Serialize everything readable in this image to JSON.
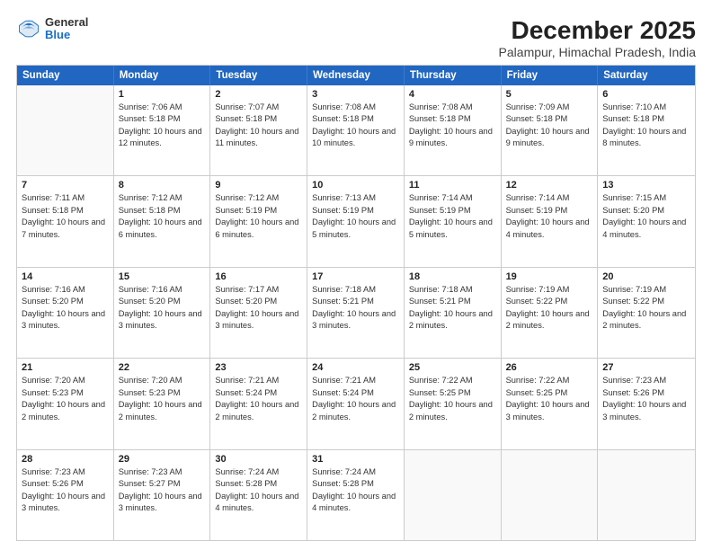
{
  "logo": {
    "general": "General",
    "blue": "Blue"
  },
  "title": "December 2025",
  "subtitle": "Palampur, Himachal Pradesh, India",
  "header_days": [
    "Sunday",
    "Monday",
    "Tuesday",
    "Wednesday",
    "Thursday",
    "Friday",
    "Saturday"
  ],
  "weeks": [
    [
      {
        "day": "",
        "sunrise": "",
        "sunset": "",
        "daylight": ""
      },
      {
        "day": "1",
        "sunrise": "Sunrise: 7:06 AM",
        "sunset": "Sunset: 5:18 PM",
        "daylight": "Daylight: 10 hours and 12 minutes."
      },
      {
        "day": "2",
        "sunrise": "Sunrise: 7:07 AM",
        "sunset": "Sunset: 5:18 PM",
        "daylight": "Daylight: 10 hours and 11 minutes."
      },
      {
        "day": "3",
        "sunrise": "Sunrise: 7:08 AM",
        "sunset": "Sunset: 5:18 PM",
        "daylight": "Daylight: 10 hours and 10 minutes."
      },
      {
        "day": "4",
        "sunrise": "Sunrise: 7:08 AM",
        "sunset": "Sunset: 5:18 PM",
        "daylight": "Daylight: 10 hours and 9 minutes."
      },
      {
        "day": "5",
        "sunrise": "Sunrise: 7:09 AM",
        "sunset": "Sunset: 5:18 PM",
        "daylight": "Daylight: 10 hours and 9 minutes."
      },
      {
        "day": "6",
        "sunrise": "Sunrise: 7:10 AM",
        "sunset": "Sunset: 5:18 PM",
        "daylight": "Daylight: 10 hours and 8 minutes."
      }
    ],
    [
      {
        "day": "7",
        "sunrise": "Sunrise: 7:11 AM",
        "sunset": "Sunset: 5:18 PM",
        "daylight": "Daylight: 10 hours and 7 minutes."
      },
      {
        "day": "8",
        "sunrise": "Sunrise: 7:12 AM",
        "sunset": "Sunset: 5:18 PM",
        "daylight": "Daylight: 10 hours and 6 minutes."
      },
      {
        "day": "9",
        "sunrise": "Sunrise: 7:12 AM",
        "sunset": "Sunset: 5:19 PM",
        "daylight": "Daylight: 10 hours and 6 minutes."
      },
      {
        "day": "10",
        "sunrise": "Sunrise: 7:13 AM",
        "sunset": "Sunset: 5:19 PM",
        "daylight": "Daylight: 10 hours and 5 minutes."
      },
      {
        "day": "11",
        "sunrise": "Sunrise: 7:14 AM",
        "sunset": "Sunset: 5:19 PM",
        "daylight": "Daylight: 10 hours and 5 minutes."
      },
      {
        "day": "12",
        "sunrise": "Sunrise: 7:14 AM",
        "sunset": "Sunset: 5:19 PM",
        "daylight": "Daylight: 10 hours and 4 minutes."
      },
      {
        "day": "13",
        "sunrise": "Sunrise: 7:15 AM",
        "sunset": "Sunset: 5:20 PM",
        "daylight": "Daylight: 10 hours and 4 minutes."
      }
    ],
    [
      {
        "day": "14",
        "sunrise": "Sunrise: 7:16 AM",
        "sunset": "Sunset: 5:20 PM",
        "daylight": "Daylight: 10 hours and 3 minutes."
      },
      {
        "day": "15",
        "sunrise": "Sunrise: 7:16 AM",
        "sunset": "Sunset: 5:20 PM",
        "daylight": "Daylight: 10 hours and 3 minutes."
      },
      {
        "day": "16",
        "sunrise": "Sunrise: 7:17 AM",
        "sunset": "Sunset: 5:20 PM",
        "daylight": "Daylight: 10 hours and 3 minutes."
      },
      {
        "day": "17",
        "sunrise": "Sunrise: 7:18 AM",
        "sunset": "Sunset: 5:21 PM",
        "daylight": "Daylight: 10 hours and 3 minutes."
      },
      {
        "day": "18",
        "sunrise": "Sunrise: 7:18 AM",
        "sunset": "Sunset: 5:21 PM",
        "daylight": "Daylight: 10 hours and 2 minutes."
      },
      {
        "day": "19",
        "sunrise": "Sunrise: 7:19 AM",
        "sunset": "Sunset: 5:22 PM",
        "daylight": "Daylight: 10 hours and 2 minutes."
      },
      {
        "day": "20",
        "sunrise": "Sunrise: 7:19 AM",
        "sunset": "Sunset: 5:22 PM",
        "daylight": "Daylight: 10 hours and 2 minutes."
      }
    ],
    [
      {
        "day": "21",
        "sunrise": "Sunrise: 7:20 AM",
        "sunset": "Sunset: 5:23 PM",
        "daylight": "Daylight: 10 hours and 2 minutes."
      },
      {
        "day": "22",
        "sunrise": "Sunrise: 7:20 AM",
        "sunset": "Sunset: 5:23 PM",
        "daylight": "Daylight: 10 hours and 2 minutes."
      },
      {
        "day": "23",
        "sunrise": "Sunrise: 7:21 AM",
        "sunset": "Sunset: 5:24 PM",
        "daylight": "Daylight: 10 hours and 2 minutes."
      },
      {
        "day": "24",
        "sunrise": "Sunrise: 7:21 AM",
        "sunset": "Sunset: 5:24 PM",
        "daylight": "Daylight: 10 hours and 2 minutes."
      },
      {
        "day": "25",
        "sunrise": "Sunrise: 7:22 AM",
        "sunset": "Sunset: 5:25 PM",
        "daylight": "Daylight: 10 hours and 2 minutes."
      },
      {
        "day": "26",
        "sunrise": "Sunrise: 7:22 AM",
        "sunset": "Sunset: 5:25 PM",
        "daylight": "Daylight: 10 hours and 3 minutes."
      },
      {
        "day": "27",
        "sunrise": "Sunrise: 7:23 AM",
        "sunset": "Sunset: 5:26 PM",
        "daylight": "Daylight: 10 hours and 3 minutes."
      }
    ],
    [
      {
        "day": "28",
        "sunrise": "Sunrise: 7:23 AM",
        "sunset": "Sunset: 5:26 PM",
        "daylight": "Daylight: 10 hours and 3 minutes."
      },
      {
        "day": "29",
        "sunrise": "Sunrise: 7:23 AM",
        "sunset": "Sunset: 5:27 PM",
        "daylight": "Daylight: 10 hours and 3 minutes."
      },
      {
        "day": "30",
        "sunrise": "Sunrise: 7:24 AM",
        "sunset": "Sunset: 5:28 PM",
        "daylight": "Daylight: 10 hours and 4 minutes."
      },
      {
        "day": "31",
        "sunrise": "Sunrise: 7:24 AM",
        "sunset": "Sunset: 5:28 PM",
        "daylight": "Daylight: 10 hours and 4 minutes."
      },
      {
        "day": "",
        "sunrise": "",
        "sunset": "",
        "daylight": ""
      },
      {
        "day": "",
        "sunrise": "",
        "sunset": "",
        "daylight": ""
      },
      {
        "day": "",
        "sunrise": "",
        "sunset": "",
        "daylight": ""
      }
    ]
  ]
}
